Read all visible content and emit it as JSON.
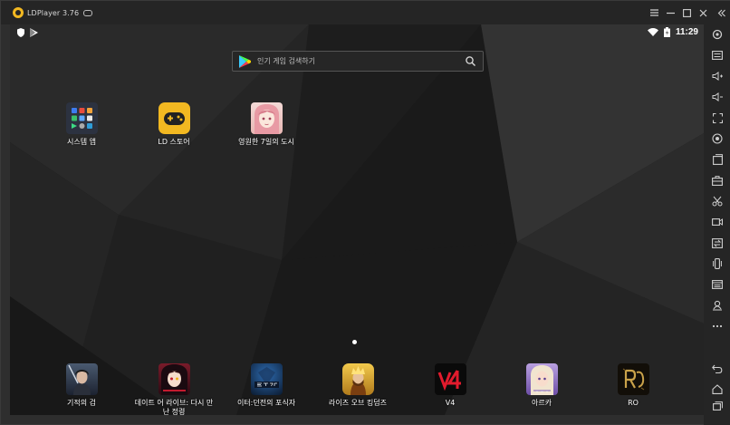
{
  "window": {
    "title": "LDPlayer 3.76"
  },
  "statusbar": {
    "time": "11:29"
  },
  "search": {
    "placeholder": "인기 게임 검색하기"
  },
  "apps_top": [
    {
      "label": "시스템 앱",
      "icon": "system-apps-folder-icon"
    },
    {
      "label": "LD 스토어",
      "icon": "ld-store-icon"
    },
    {
      "label": "영원한 7일의 도시",
      "icon": "game-anime-girl-icon"
    }
  ],
  "apps_dock": [
    {
      "label": "기적의 검",
      "icon": "game-warrior-icon"
    },
    {
      "label": "데이트 어 라이브: 다시 만\n난 정령",
      "icon": "game-date-a-live-icon"
    },
    {
      "label": "이터:던전의 포식자",
      "icon": "game-eater-icon"
    },
    {
      "label": "라이즈 오브 킹덤즈",
      "icon": "game-rise-of-kingdoms-icon"
    },
    {
      "label": "V4",
      "icon": "game-v4-icon"
    },
    {
      "label": "아르카",
      "icon": "game-arca-icon"
    },
    {
      "label": "RO",
      "icon": "game-ro-icon"
    }
  ],
  "colors": {
    "accent": "#f2b821",
    "titlebar": "#252525",
    "sidebar": "#252525"
  }
}
